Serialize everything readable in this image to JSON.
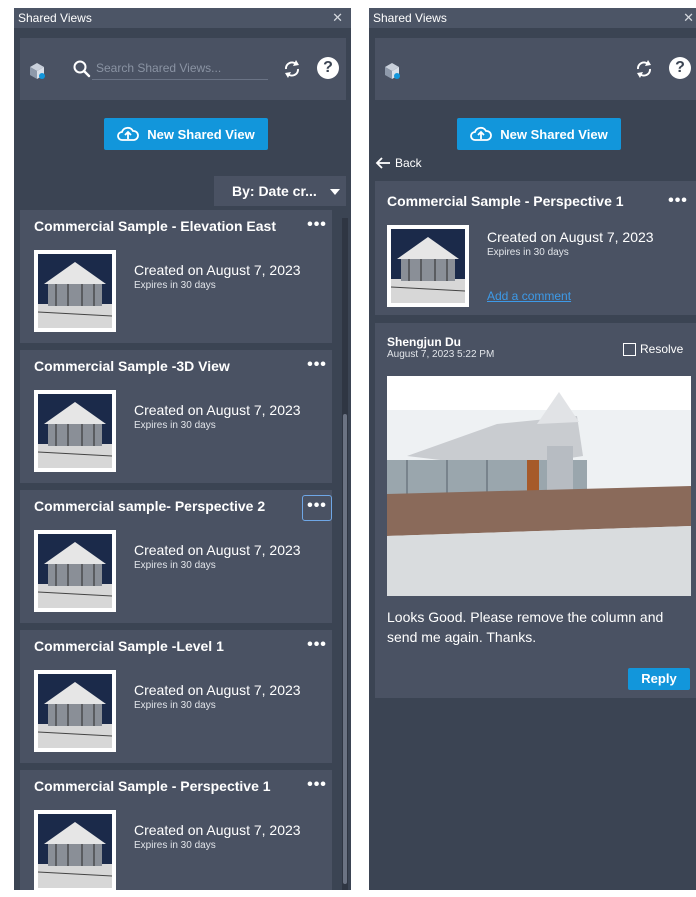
{
  "left_panel": {
    "title": "Shared Views",
    "close_glyph": "✕",
    "search": {
      "placeholder": "Search Shared Views..."
    },
    "help_glyph": "?",
    "new_button_label": "New Shared View",
    "sort_label": "By: Date cr...",
    "more_glyph": "•••",
    "views": [
      {
        "title": "Commercial Sample - Elevation East",
        "created": "Created on August 7, 2023",
        "expires": "Expires in 30 days"
      },
      {
        "title": "Commercial Sample -3D View",
        "created": "Created on August 7, 2023",
        "expires": "Expires in 30 days"
      },
      {
        "title": "Commercial sample- Perspective 2",
        "created": "Created on August 7, 2023",
        "expires": "Expires in 30 days"
      },
      {
        "title": "Commercial Sample -Level 1",
        "created": "Created on August 7, 2023",
        "expires": "Expires in 30 days"
      },
      {
        "title": "Commercial Sample - Perspective 1",
        "created": "Created on August 7, 2023",
        "expires": "Expires in 30 days"
      }
    ]
  },
  "right_panel": {
    "title": "Shared Views",
    "close_glyph": "✕",
    "help_glyph": "?",
    "new_button_label": "New Shared View",
    "back_label": "Back",
    "more_glyph": "•••",
    "view": {
      "title": "Commercial Sample - Perspective 1",
      "created": "Created on August 7, 2023",
      "expires": "Expires in 30 days",
      "add_comment_label": "Add a comment"
    },
    "comment": {
      "author": "Shengjun Du",
      "date": "August 7, 2023 5:22 PM",
      "resolve_label": "Resolve",
      "text": "Looks Good. Please remove the column and send me again. Thanks.",
      "reply_label": "Reply"
    }
  },
  "icons": {
    "cube": "cube-icon",
    "search": "search-icon",
    "sync": "sync-icon",
    "help": "help-icon",
    "cloud_upload": "cloud-upload-icon",
    "back_arrow": "arrow-left-icon",
    "more": "more-horizontal-icon",
    "close": "close-icon"
  },
  "colors": {
    "panel_bg": "#3b4453",
    "card_bg": "#4a5263",
    "accent_blue": "#1296db",
    "link_blue": "#3d9ae8",
    "text": "#ffffff"
  }
}
